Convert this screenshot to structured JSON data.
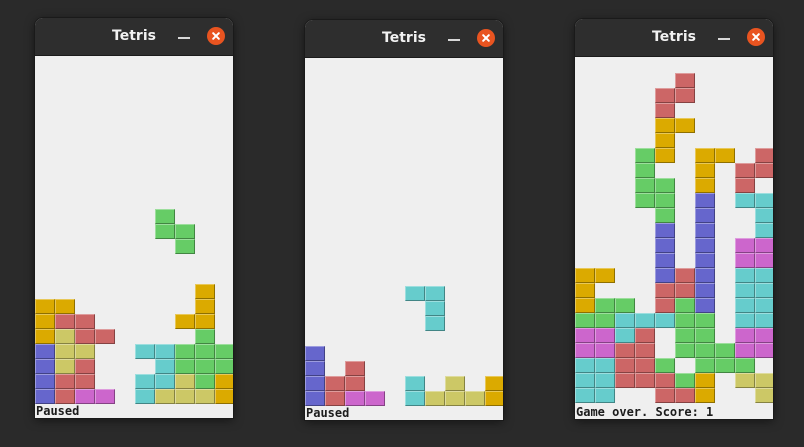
{
  "colors": {
    "I": "#66cccc",
    "O": "#ccc866",
    "T": "#cc66cc",
    "S": "#66cc66",
    "Z": "#cc6666",
    "J": "#6666cc",
    "L": "#dbaa00"
  },
  "windows": [
    {
      "title": "Tetris",
      "status": "Paused",
      "cells": [
        [
          6,
          8,
          "S"
        ],
        [
          6,
          9,
          "S"
        ],
        [
          7,
          9,
          "S"
        ],
        [
          7,
          10,
          "S"
        ],
        [
          8,
          13,
          "L"
        ],
        [
          8,
          14,
          "L"
        ],
        [
          7,
          15,
          "L"
        ],
        [
          8,
          15,
          "L"
        ],
        [
          8,
          16,
          "S"
        ],
        [
          0,
          14,
          "L"
        ],
        [
          1,
          14,
          "L"
        ],
        [
          0,
          15,
          "L"
        ],
        [
          1,
          15,
          "Z"
        ],
        [
          2,
          15,
          "Z"
        ],
        [
          0,
          16,
          "L"
        ],
        [
          1,
          16,
          "O"
        ],
        [
          2,
          16,
          "Z"
        ],
        [
          3,
          16,
          "Z"
        ],
        [
          0,
          17,
          "J"
        ],
        [
          1,
          17,
          "O"
        ],
        [
          2,
          17,
          "O"
        ],
        [
          5,
          17,
          "I"
        ],
        [
          6,
          17,
          "I"
        ],
        [
          7,
          17,
          "S"
        ],
        [
          8,
          17,
          "S"
        ],
        [
          9,
          17,
          "S"
        ],
        [
          0,
          18,
          "J"
        ],
        [
          1,
          18,
          "O"
        ],
        [
          2,
          18,
          "Z"
        ],
        [
          6,
          18,
          "I"
        ],
        [
          7,
          18,
          "S"
        ],
        [
          8,
          18,
          "S"
        ],
        [
          9,
          18,
          "S"
        ],
        [
          0,
          19,
          "J"
        ],
        [
          1,
          19,
          "Z"
        ],
        [
          2,
          19,
          "Z"
        ],
        [
          5,
          19,
          "I"
        ],
        [
          6,
          19,
          "I"
        ],
        [
          7,
          19,
          "O"
        ],
        [
          8,
          19,
          "S"
        ],
        [
          9,
          19,
          "L"
        ],
        [
          0,
          20,
          "J"
        ],
        [
          1,
          20,
          "Z"
        ],
        [
          2,
          20,
          "T"
        ],
        [
          3,
          20,
          "T"
        ],
        [
          5,
          20,
          "I"
        ],
        [
          6,
          20,
          "O"
        ],
        [
          7,
          20,
          "O"
        ],
        [
          8,
          20,
          "O"
        ],
        [
          9,
          20,
          "L"
        ]
      ]
    },
    {
      "title": "Tetris",
      "status": "Paused",
      "cells": [
        [
          5,
          13,
          "I"
        ],
        [
          6,
          13,
          "I"
        ],
        [
          6,
          14,
          "I"
        ],
        [
          6,
          15,
          "I"
        ],
        [
          0,
          17,
          "J"
        ],
        [
          0,
          18,
          "J"
        ],
        [
          2,
          18,
          "Z"
        ],
        [
          0,
          19,
          "J"
        ],
        [
          1,
          19,
          "Z"
        ],
        [
          2,
          19,
          "Z"
        ],
        [
          5,
          19,
          "I"
        ],
        [
          7,
          19,
          "O"
        ],
        [
          9,
          19,
          "L"
        ],
        [
          0,
          20,
          "J"
        ],
        [
          1,
          20,
          "Z"
        ],
        [
          2,
          20,
          "T"
        ],
        [
          3,
          20,
          "T"
        ],
        [
          5,
          20,
          "I"
        ],
        [
          6,
          20,
          "O"
        ],
        [
          7,
          20,
          "O"
        ],
        [
          8,
          20,
          "O"
        ],
        [
          9,
          20,
          "L"
        ]
      ]
    },
    {
      "title": "Tetris",
      "status": "Game over. Score: 1",
      "cells": [
        [
          5,
          0,
          "Z"
        ],
        [
          4,
          1,
          "Z"
        ],
        [
          5,
          1,
          "Z"
        ],
        [
          4,
          2,
          "Z"
        ],
        [
          4,
          3,
          "L"
        ],
        [
          5,
          3,
          "L"
        ],
        [
          4,
          4,
          "L"
        ],
        [
          3,
          5,
          "S"
        ],
        [
          4,
          5,
          "L"
        ],
        [
          6,
          5,
          "L"
        ],
        [
          7,
          5,
          "L"
        ],
        [
          9,
          5,
          "Z"
        ],
        [
          3,
          6,
          "S"
        ],
        [
          6,
          6,
          "L"
        ],
        [
          8,
          6,
          "Z"
        ],
        [
          9,
          6,
          "Z"
        ],
        [
          3,
          7,
          "S"
        ],
        [
          4,
          7,
          "S"
        ],
        [
          6,
          7,
          "L"
        ],
        [
          8,
          7,
          "Z"
        ],
        [
          3,
          8,
          "S"
        ],
        [
          4,
          8,
          "S"
        ],
        [
          6,
          8,
          "J"
        ],
        [
          8,
          8,
          "I"
        ],
        [
          9,
          8,
          "I"
        ],
        [
          4,
          9,
          "S"
        ],
        [
          6,
          9,
          "J"
        ],
        [
          9,
          9,
          "I"
        ],
        [
          4,
          10,
          "J"
        ],
        [
          6,
          10,
          "J"
        ],
        [
          9,
          10,
          "I"
        ],
        [
          4,
          11,
          "J"
        ],
        [
          6,
          11,
          "J"
        ],
        [
          8,
          11,
          "T"
        ],
        [
          9,
          11,
          "T"
        ],
        [
          4,
          12,
          "J"
        ],
        [
          6,
          12,
          "J"
        ],
        [
          8,
          12,
          "T"
        ],
        [
          9,
          12,
          "T"
        ],
        [
          0,
          13,
          "L"
        ],
        [
          1,
          13,
          "L"
        ],
        [
          4,
          13,
          "J"
        ],
        [
          5,
          13,
          "Z"
        ],
        [
          6,
          13,
          "J"
        ],
        [
          8,
          13,
          "I"
        ],
        [
          9,
          13,
          "I"
        ],
        [
          0,
          14,
          "L"
        ],
        [
          4,
          14,
          "Z"
        ],
        [
          5,
          14,
          "Z"
        ],
        [
          6,
          14,
          "J"
        ],
        [
          8,
          14,
          "I"
        ],
        [
          9,
          14,
          "I"
        ],
        [
          0,
          15,
          "L"
        ],
        [
          1,
          15,
          "S"
        ],
        [
          2,
          15,
          "S"
        ],
        [
          4,
          15,
          "Z"
        ],
        [
          5,
          15,
          "S"
        ],
        [
          6,
          15,
          "J"
        ],
        [
          8,
          15,
          "I"
        ],
        [
          9,
          15,
          "I"
        ],
        [
          0,
          16,
          "S"
        ],
        [
          1,
          16,
          "S"
        ],
        [
          2,
          16,
          "I"
        ],
        [
          3,
          16,
          "I"
        ],
        [
          4,
          16,
          "I"
        ],
        [
          5,
          16,
          "S"
        ],
        [
          6,
          16,
          "S"
        ],
        [
          8,
          16,
          "I"
        ],
        [
          9,
          16,
          "I"
        ],
        [
          0,
          17,
          "T"
        ],
        [
          1,
          17,
          "T"
        ],
        [
          2,
          17,
          "I"
        ],
        [
          3,
          17,
          "Z"
        ],
        [
          5,
          17,
          "S"
        ],
        [
          6,
          17,
          "S"
        ],
        [
          8,
          17,
          "T"
        ],
        [
          9,
          17,
          "T"
        ],
        [
          0,
          18,
          "T"
        ],
        [
          1,
          18,
          "T"
        ],
        [
          2,
          18,
          "Z"
        ],
        [
          3,
          18,
          "Z"
        ],
        [
          5,
          18,
          "S"
        ],
        [
          6,
          18,
          "S"
        ],
        [
          7,
          18,
          "S"
        ],
        [
          8,
          18,
          "T"
        ],
        [
          9,
          18,
          "T"
        ],
        [
          0,
          19,
          "I"
        ],
        [
          1,
          19,
          "I"
        ],
        [
          2,
          19,
          "Z"
        ],
        [
          3,
          19,
          "Z"
        ],
        [
          4,
          19,
          "S"
        ],
        [
          6,
          19,
          "S"
        ],
        [
          7,
          19,
          "S"
        ],
        [
          8,
          19,
          "S"
        ],
        [
          0,
          20,
          "I"
        ],
        [
          1,
          20,
          "I"
        ],
        [
          2,
          20,
          "Z"
        ],
        [
          3,
          20,
          "Z"
        ],
        [
          4,
          20,
          "Z"
        ],
        [
          5,
          20,
          "S"
        ],
        [
          6,
          20,
          "L"
        ],
        [
          8,
          20,
          "O"
        ],
        [
          9,
          20,
          "O"
        ],
        [
          0,
          21,
          "I"
        ],
        [
          1,
          21,
          "I"
        ],
        [
          4,
          21,
          "Z"
        ],
        [
          5,
          21,
          "Z"
        ],
        [
          6,
          21,
          "L"
        ],
        [
          9,
          21,
          "O"
        ]
      ]
    }
  ]
}
